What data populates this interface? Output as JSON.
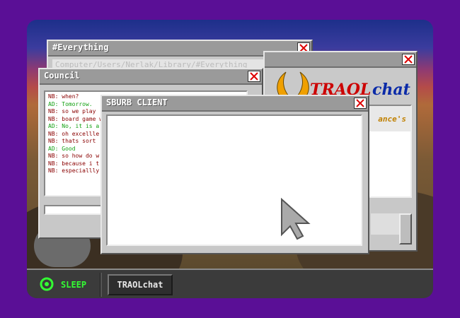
{
  "windows": {
    "everything": {
      "title": "#Everything",
      "path": "Computer/Users/Nerlak/Library/#Everything"
    },
    "council": {
      "title": "Council",
      "messages": [
        {
          "who": "NB",
          "text": "when?"
        },
        {
          "who": "AD",
          "text": "Tomorrow."
        },
        {
          "who": "NB",
          "text": "so we play"
        },
        {
          "who": "NB",
          "text": "board game with"
        },
        {
          "who": "AD",
          "text": "No, it is a"
        },
        {
          "who": "NB",
          "text": "oh excellle"
        },
        {
          "who": "NB",
          "text": "thats sort"
        },
        {
          "who": "AD",
          "text": "Good"
        },
        {
          "who": "NB",
          "text": "so how do w"
        },
        {
          "who": "NB",
          "text": "because i t"
        },
        {
          "who": "NB",
          "text": "especiallly"
        }
      ]
    },
    "traol": {
      "logo_part1": "TRAOL",
      "logo_part2": "chat",
      "panel_text": "ance's"
    },
    "sburb": {
      "title": "SBURB CLIENT"
    }
  },
  "taskbar": {
    "sleep_label": "SLEEP",
    "task_label": "TRAOLchat"
  },
  "colors": {
    "nb": "#8a0000",
    "ad": "#11a011",
    "sleep": "#33ff33",
    "traol_red": "#cc0000",
    "chat_blue": "#0a2aa8"
  },
  "icons": [
    "close-icon",
    "sleep-icon",
    "cursor-icon",
    "horns-logo-icon"
  ]
}
